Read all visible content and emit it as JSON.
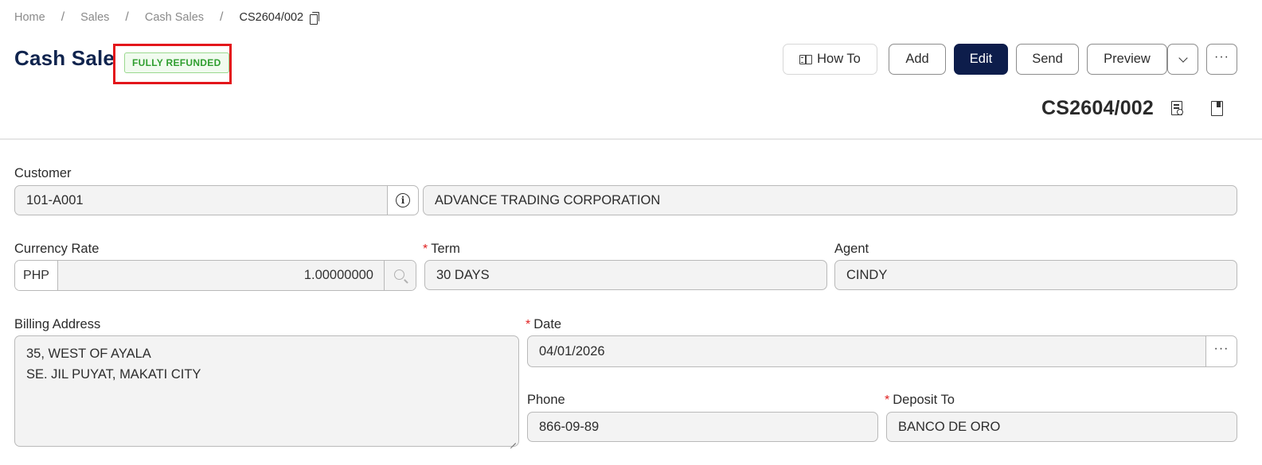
{
  "breadcrumb": {
    "items": [
      "Home",
      "Sales",
      "Cash Sales"
    ],
    "current": "CS2604/002",
    "separator": "/"
  },
  "header": {
    "title": "Cash Sale",
    "status": "FULLY REFUNDED",
    "document_number": "CS2604/002"
  },
  "toolbar": {
    "how_to": "How To",
    "add": "Add",
    "edit": "Edit",
    "send": "Send",
    "preview": "Preview",
    "more": "···"
  },
  "form": {
    "customer": {
      "label": "Customer",
      "code": "101-A001",
      "name": "ADVANCE TRADING CORPORATION"
    },
    "currency_rate": {
      "label": "Currency Rate",
      "currency": "PHP",
      "rate": "1.00000000"
    },
    "term": {
      "label": "Term",
      "value": "30 DAYS",
      "required": "*"
    },
    "agent": {
      "label": "Agent",
      "value": "CINDY"
    },
    "billing_address": {
      "label": "Billing Address",
      "line1": "35, WEST OF AYALA",
      "line2": "SE. JIL PUYAT, MAKATI CITY"
    },
    "date": {
      "label": "Date",
      "value": "04/01/2026",
      "required": "*",
      "more": "···"
    },
    "phone": {
      "label": "Phone",
      "value": "866-09-89"
    },
    "deposit_to": {
      "label": "Deposit To",
      "value": "BANCO DE ORO",
      "required": "*"
    }
  },
  "colors": {
    "title": "#10244e",
    "primary_button": "#0d1d4b",
    "badge_text": "#2f9e2f",
    "badge_bg": "#f1fbef",
    "highlight": "#e3161b",
    "required": "#e02020"
  }
}
